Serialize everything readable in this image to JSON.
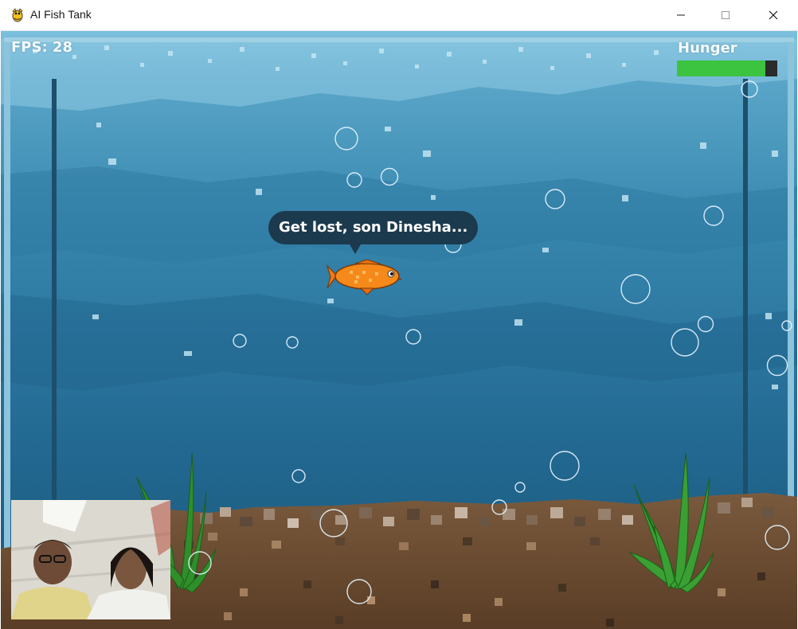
{
  "window": {
    "title": "AI Fish Tank",
    "controls": {
      "minimize": "minimize-icon",
      "maximize": "maximize-icon",
      "close": "close-icon"
    }
  },
  "hud": {
    "fps_label": "FPS: 28",
    "hunger_label": "Hunger",
    "hunger_level": 0.88,
    "hunger_color": "#3cc33f"
  },
  "fish": {
    "speech": "Get lost, son Dinesha..."
  },
  "colors": {
    "water_top": "#6ab3d4",
    "water_mid": "#2f7aa2",
    "water_deep": "#1b5a7c",
    "bubble": "#e8f6ff",
    "speech_bg": "#1c3a4d"
  }
}
